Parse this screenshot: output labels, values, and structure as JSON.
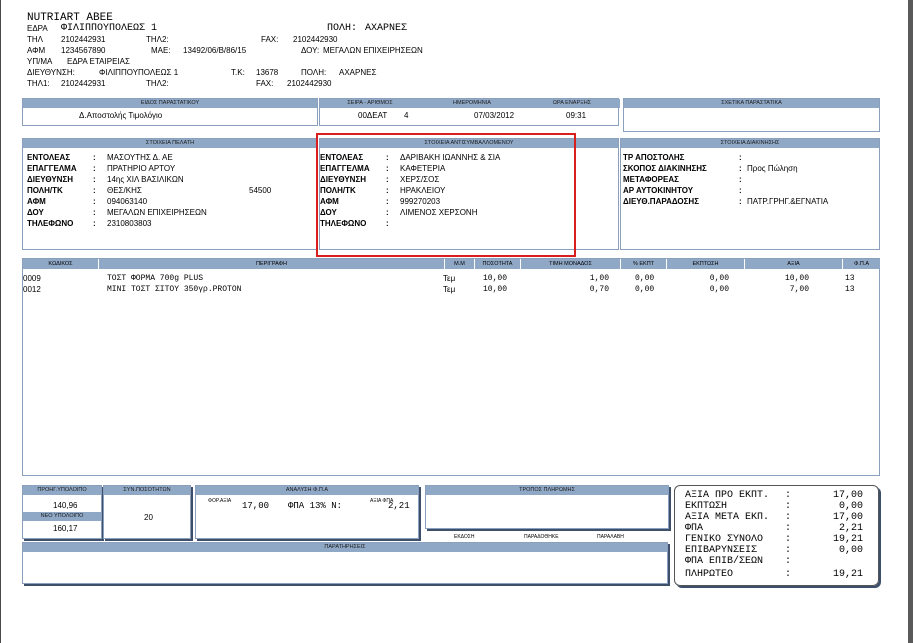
{
  "company": {
    "name": "NUTRIART ABEE",
    "hq_label": "ΕΔΡΑ",
    "hq_value": "ΦΙΛΙΠΠΟΥΠΟΛΕΩΣ 1",
    "city_label": "ΠΟΛΗ:",
    "city_value": "ΑΧΑΡΝΕΣ",
    "tel_label": "ΤΗΛ",
    "tel_value": "2102442931",
    "tel2_label": "ΤΗΛ2:",
    "fax_label": "FAX:",
    "fax_value": "2102442930",
    "afm_label": "ΑΦΜ",
    "afm_value": "1234567890",
    "mae_label": "ΜΑΕ:",
    "mae_value": "13492/06/Β/86/15",
    "doy_label": "ΔΟΥ:",
    "doy_value": "ΜΕΓΑΛΩΝ ΕΠΙΧΕΙΡΗΣΕΩΝ",
    "branch_label": "ΥΠ/ΜΑ",
    "branch_value": "ΕΔΡΑ ΕΤΑΙΡΕΙΑΣ",
    "addr_label": "ΔΙΕΥΘΥΝΣΗ:",
    "addr_value": "ΦΙΛΙΠΠΟΥΠΟΛΕΩΣ 1",
    "tk_label": "Τ.Κ:",
    "tk_value": "13678",
    "city2_label": "ΠΟΛΗ:",
    "city2_value": "ΑΧΑΡΝΕΣ",
    "tel1_label": "ΤΗΛ1:",
    "tel1_value": "2102442931",
    "tel2b_label": "ΤΗΛ2:",
    "fax2_label": "FAX:",
    "fax2_value": "2102442930"
  },
  "doc": {
    "type_title": "ΕΙΔΟΣ ΠΑΡΑΣΤΑΤΙΚΟΥ",
    "type_value": "Δ.Αποστολής Τιμολόγιο",
    "series_title": "ΣΕΙΡΑ - ΑΡΙΘΜΟΣ",
    "series_value": "00ΔΕΑΤ",
    "number_value": "4",
    "date_title": "ΗΜΕΡΟΜΗΝΙΑ",
    "date_value": "07/03/2012",
    "time_title": "ΩΡΑ ΕΝΑΡΞΗΣ",
    "time_value": "09:31",
    "related_title": "ΣΧΕΤΙΚΑ ΠΑΡΑΣΤΑΤΙΚΑ"
  },
  "client": {
    "title": "ΣΤΟΙΧΕΙΑ ΠΕΛΑΤΗ",
    "rows": [
      {
        "label": "ΕΝΤΟΛΕΑΣ",
        "value": "ΜΑΣΟΥΤΗΣ Δ. ΑΕ",
        "extra": ""
      },
      {
        "label": "ΕΠΑΓΓΕΛΜΑ",
        "value": "ΠΡΑΤΗΡΙΟ ΑΡΤΟΥ",
        "extra": ""
      },
      {
        "label": "ΔΙΕΥΘΥΝΣΗ",
        "value": "14ης ΧΙΛ ΒΑΣΙΛΙΚΩΝ",
        "extra": ""
      },
      {
        "label": "ΠΟΛΗ/ΤΚ",
        "value": "ΘΕΣ/ΚΗΣ",
        "extra": "54500"
      },
      {
        "label": "ΑΦΜ",
        "value": "094063140",
        "extra": ""
      },
      {
        "label": "ΔΟΥ",
        "value": "ΜΕΓΑΛΩΝ ΕΠΙΧΕΙΡΗΣΕΩΝ",
        "extra": ""
      },
      {
        "label": "ΤΗΛΕΦΩΝΟ",
        "value": "2310803803",
        "extra": ""
      }
    ]
  },
  "counterparty": {
    "title": "ΣΤΟΙΧΕΙΑ ΑΝΤΙΣΥΜΒΑΛΛΟΜΕΝΟΥ",
    "rows": [
      {
        "label": "ΕΝΤΟΛΕΑΣ",
        "value": "ΔΑΡΙΒΑΚΗ ΙΩΑΝΝΗΣ & ΣΙΑ"
      },
      {
        "label": "ΕΠΑΓΓΕΛΜΑ",
        "value": "ΚΑΦΕΤΕΡΙΑ"
      },
      {
        "label": "ΔΙΕΥΘΥΝΣΗ",
        "value": "ΧΕΡΣ/ΣΟΣ"
      },
      {
        "label": "ΠΟΛΗ/ΤΚ",
        "value": "ΗΡΑΚΛΕΙΟΥ"
      },
      {
        "label": "ΑΦΜ",
        "value": "999270203"
      },
      {
        "label": "ΔΟΥ",
        "value": "ΛΙΜΕΝΟΣ ΧΕΡΣΟΝΗ"
      },
      {
        "label": "ΤΗΛΕΦΩΝΟ",
        "value": ""
      }
    ]
  },
  "shipping": {
    "title": "ΣΤΟΙΧΕΙΑ ΔΙΑΚΙΝΗΣΗΣ",
    "rows": [
      {
        "label": "ΤΡ ΑΠΟΣΤΟΛΗΣ",
        "value": ""
      },
      {
        "label": "ΣΚΟΠΟΣ ΔΙΑΚΙΝΗΣΗΣ",
        "value": "Προς Πώληση"
      },
      {
        "label": "ΜΕΤΑΦΟΡΕΑΣ",
        "value": ""
      },
      {
        "label": "ΑΡ ΑΥΤΟΚΙΝΗΤΟΥ",
        "value": ""
      },
      {
        "label": "ΔΙΕΥΘ.ΠΑΡΑΔΟΣΗΣ",
        "value": "ΠΑΤΡ.ΓΡΗΓ.&ΕΓΝΑΤΙΑ"
      }
    ]
  },
  "lines": {
    "headers": [
      "ΚΩΔΙΚΟΣ",
      "ΠΕΡΙΓΡΑΦΗ",
      "Μ.Μ",
      "ΠΟΣΟΤΗΤΑ",
      "ΤΙΜΗ ΜΟΝΑΔΟΣ",
      "% ΕΚΠΤ",
      "ΕΚΠΤΩΣΗ",
      "ΑΞΙΑ",
      "Φ.Π.Α"
    ],
    "items": [
      {
        "code": "0009",
        "desc": "ΤΟΣΤ ΦΟΡΜΑ 700g PLUS",
        "unit": "Τεμ",
        "qty": "10,00",
        "price": "1,00",
        "disc_pct": "0,00",
        "disc": "0,00",
        "value": "10,00",
        "vat": "13"
      },
      {
        "code": "0012",
        "desc": "ΜΙΝΙ ΤΟΣΤ ΣΙΤΟΥ 350γρ.PROTON",
        "unit": "Τεμ",
        "qty": "10,00",
        "price": "0,70",
        "disc_pct": "0,00",
        "disc": "0,00",
        "value": "7,00",
        "vat": "13"
      }
    ]
  },
  "balance": {
    "prev_title": "ΠΡΟΗΓ.ΥΠΟΛΟΙΠΟ",
    "prev_value": "140,96",
    "new_title": "ΝΕΟ ΥΠΟΛΟΙΠΟ",
    "new_value": "160,17",
    "qty_title": "ΣΥΝ.ΠΟΣΟΤΗΤΩΝ",
    "qty_value": "20"
  },
  "vat": {
    "title": "ΑΝΑΛΥΣΗ Φ.Π.Α",
    "base_label": "ΦΟΡ.ΑΞΙΑ",
    "base_value": "17,00",
    "rate_label": "ΦΠΑ 13% Ν:",
    "amount_label": "ΑΞΙΑ ΦΠΑ",
    "amount_value": "2,21"
  },
  "payment": {
    "title": "ΤΡΟΠΟΣ ΠΛΗΡΩΜΗΣ",
    "sig1": "ΕΚΔΟΣΗ",
    "sig2": "ΠΑΡΑΔΟΘΗΚΕ",
    "sig3": "ΠΑΡΑΛΑΒΗ"
  },
  "remarks": {
    "title": "ΠΑΡΑΤΗΡΗΣΕΙΣ"
  },
  "totals": [
    {
      "label": "ΑΞΙΑ ΠΡΟ ΕΚΠΤ.",
      "value": "17,00"
    },
    {
      "label": "ΕΚΠΤΩΣΗ",
      "value": "0,00"
    },
    {
      "label": "ΑΞΙΑ ΜΕΤΑ ΕΚΠ.",
      "value": "17,00"
    },
    {
      "label": "ΦΠΑ",
      "value": "2,21"
    },
    {
      "label": "ΓΕΝΙΚΟ ΣΥΝΟΛΟ",
      "value": "19,21"
    },
    {
      "label": "ΕΠΙΒΑΡΥΝΣΕΙΣ",
      "value": "0,00"
    },
    {
      "label": "ΦΠΑ ΕΠΙΒ/ΣΕΩΝ",
      "value": ""
    },
    {
      "label": "ΠΛΗΡΩΤΕΟ",
      "value": "19,21"
    }
  ],
  "colon": ":"
}
